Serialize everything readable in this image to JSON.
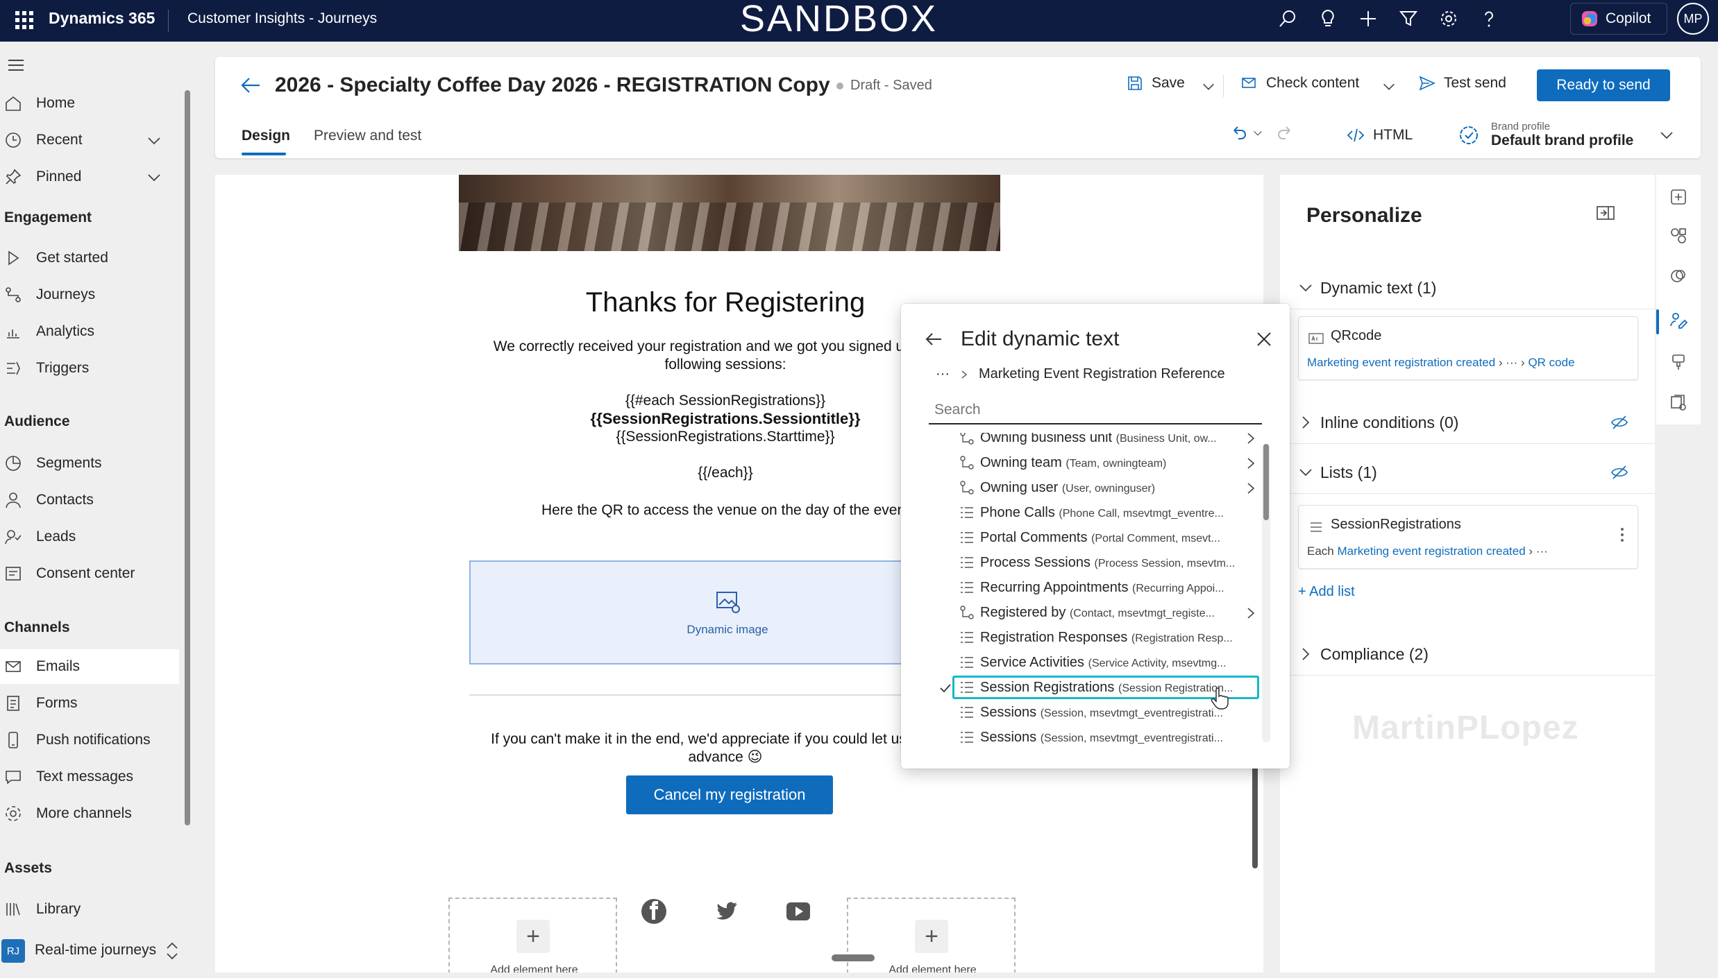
{
  "topbar": {
    "brand": "Dynamics 365",
    "app_name": "Customer Insights - Journeys",
    "environment_banner": "SANDBOX",
    "icons": [
      "search-icon",
      "lightbulb-icon",
      "plus-icon",
      "filter-icon",
      "gear-icon",
      "help-icon"
    ],
    "copilot_label": "Copilot",
    "avatar_initials": "MP"
  },
  "nav": {
    "home": "Home",
    "recent": "Recent",
    "pinned": "Pinned",
    "engagement_header": "Engagement",
    "get_started": "Get started",
    "journeys": "Journeys",
    "analytics": "Analytics",
    "triggers": "Triggers",
    "audience_header": "Audience",
    "segments": "Segments",
    "contacts": "Contacts",
    "leads": "Leads",
    "consent_center": "Consent center",
    "channels_header": "Channels",
    "emails": "Emails",
    "forms": "Forms",
    "push_notifications": "Push notifications",
    "text_messages": "Text messages",
    "more_channels": "More channels",
    "assets_header": "Assets",
    "library": "Library",
    "area_badge": "RJ",
    "area_label": "Real-time journeys"
  },
  "header": {
    "title": "2026 - Specialty Coffee Day 2026 - REGISTRATION Copy",
    "status": "Draft - Saved",
    "save_label": "Save",
    "check_content_label": "Check content",
    "test_send_label": "Test send",
    "ready_label": "Ready to send",
    "tab_design": "Design",
    "tab_preview": "Preview and test",
    "html_label": "HTML",
    "brand_profile_small": "Brand profile",
    "brand_profile_value": "Default brand profile"
  },
  "email": {
    "heading": "Thanks for Registering",
    "intro_line1": "We correctly received your registration and we got you signed up for the",
    "intro_line2": "following sessions:",
    "each_open": "{{#each SessionRegistrations}}",
    "session_title": "{{SessionRegistrations.Sessiontitle}}",
    "session_start": "{{SessionRegistrations.Starttime}}",
    "each_close": "{{/each}}",
    "qr_text": "Here the QR to access the venue on the day of the event",
    "dynamic_image_label": "Dynamic image",
    "cancel_text_line1": "If you can't make it in the end, we'd appreciate if you could let us know in",
    "cancel_text_line2": "advance 😉",
    "cancel_button": "Cancel my registration",
    "add_element_label": "Add element here"
  },
  "popup": {
    "title": "Edit dynamic text",
    "breadcrumb_more": "···",
    "breadcrumb_current": "Marketing Event Registration Reference",
    "search_placeholder": "Search",
    "rows": [
      {
        "label": "Owning business unit",
        "sub": "(Business Unit, ow...",
        "has_chevron": true,
        "icon": "relation-icon"
      },
      {
        "label": "Owning team",
        "sub": "(Team, owningteam)",
        "has_chevron": true,
        "icon": "relation-icon"
      },
      {
        "label": "Owning user",
        "sub": "(User, owninguser)",
        "has_chevron": true,
        "icon": "relation-icon"
      },
      {
        "label": "Phone Calls",
        "sub": "(Phone Call, msevtmgt_eventre...",
        "has_chevron": false,
        "icon": "list-icon"
      },
      {
        "label": "Portal Comments",
        "sub": "(Portal Comment, msevt...",
        "has_chevron": false,
        "icon": "list-icon"
      },
      {
        "label": "Process Sessions",
        "sub": "(Process Session, msevtm...",
        "has_chevron": false,
        "icon": "list-icon"
      },
      {
        "label": "Recurring Appointments",
        "sub": "(Recurring Appoi...",
        "has_chevron": false,
        "icon": "list-icon"
      },
      {
        "label": "Registered by",
        "sub": "(Contact, msevtmgt_registe...",
        "has_chevron": true,
        "icon": "relation-icon"
      },
      {
        "label": "Registration Responses",
        "sub": "(Registration Resp...",
        "has_chevron": false,
        "icon": "list-icon"
      },
      {
        "label": "Service Activities",
        "sub": "(Service Activity, msevtmg...",
        "has_chevron": false,
        "icon": "list-icon"
      },
      {
        "label": "Session Registrations",
        "sub": "(Session Registration...",
        "has_chevron": false,
        "icon": "list-icon",
        "selected": true
      },
      {
        "label": "Sessions",
        "sub": "(Session, msevtmgt_eventregistrati...",
        "has_chevron": false,
        "icon": "list-icon"
      },
      {
        "label": "Sessions",
        "sub": "(Session, msevtmgt_eventregistrati...",
        "has_chevron": false,
        "icon": "list-icon"
      }
    ]
  },
  "personalize": {
    "title": "Personalize",
    "dynamic_text_header": "Dynamic text (1)",
    "qr_card_title": "QRcode",
    "qr_card_path_1": "Marketing event registration created",
    "qr_card_path_more": "···",
    "qr_card_path_2": "QR code",
    "inline_conditions_header": "Inline conditions (0)",
    "lists_header": "Lists (1)",
    "list_card_title": "SessionRegistrations",
    "list_card_each": "Each",
    "list_card_path": "Marketing event registration created",
    "list_card_more": "···",
    "add_list": "+ Add list",
    "compliance_header": "Compliance (2)",
    "watermark": "MartinPLopez"
  },
  "colors": {
    "topbar": "#0f1c42",
    "accent": "#0f6cbd",
    "selection_outline": "#16b8c8"
  }
}
